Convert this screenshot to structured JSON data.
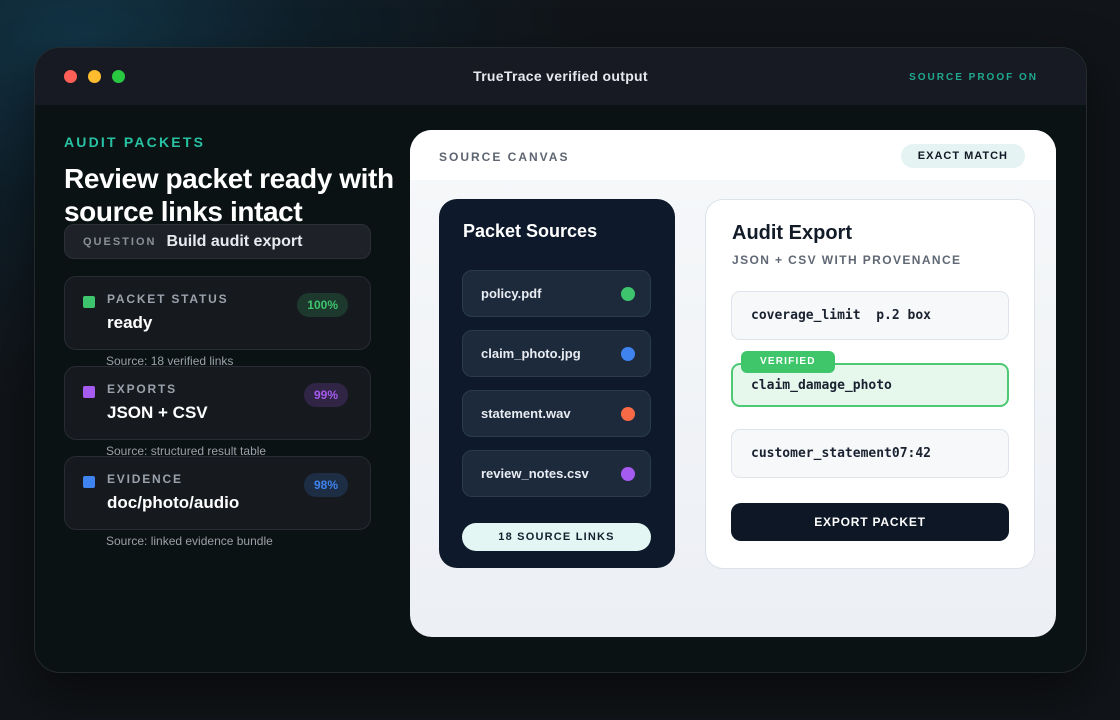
{
  "window": {
    "title": "TrueTrace verified output",
    "status": "SOURCE PROOF ON"
  },
  "left": {
    "eyebrow": "AUDIT PACKETS",
    "headline": "Review packet ready with source links intact",
    "question": {
      "tag": "QUESTION",
      "text": "Build audit export"
    },
    "stats": [
      {
        "label": "PACKET STATUS",
        "value": "ready",
        "badge": "100%",
        "source": "Source: 18 verified links",
        "color": "#3ec46d"
      },
      {
        "label": "EXPORTS",
        "value": "JSON + CSV",
        "badge": "99%",
        "source": "Source: structured result table",
        "color": "#a55bef"
      },
      {
        "label": "EVIDENCE",
        "value": "doc/photo/audio",
        "badge": "98%",
        "source": "Source: linked evidence bundle",
        "color": "#3f83f0"
      }
    ]
  },
  "canvas": {
    "title": "SOURCE CANVAS",
    "badge": "EXACT MATCH",
    "sources": {
      "title": "Packet Sources",
      "items": [
        {
          "name": "policy.pdf",
          "color": "#3ec46d"
        },
        {
          "name": "claim_photo.jpg",
          "color": "#3f83f0"
        },
        {
          "name": "statement.wav",
          "color": "#f76a45"
        },
        {
          "name": "review_notes.csv",
          "color": "#a55bef"
        }
      ],
      "links_label": "18 SOURCE LINKS"
    },
    "export": {
      "title": "Audit Export",
      "subtitle": "JSON + CSV WITH PROVENANCE",
      "fields": [
        {
          "text": "coverage_limit  p.2 box"
        },
        {
          "text": "claim_damage_photo",
          "tag": "VERIFIED"
        },
        {
          "text": "customer_statement07:42"
        }
      ],
      "button_label": "EXPORT PACKET"
    }
  }
}
